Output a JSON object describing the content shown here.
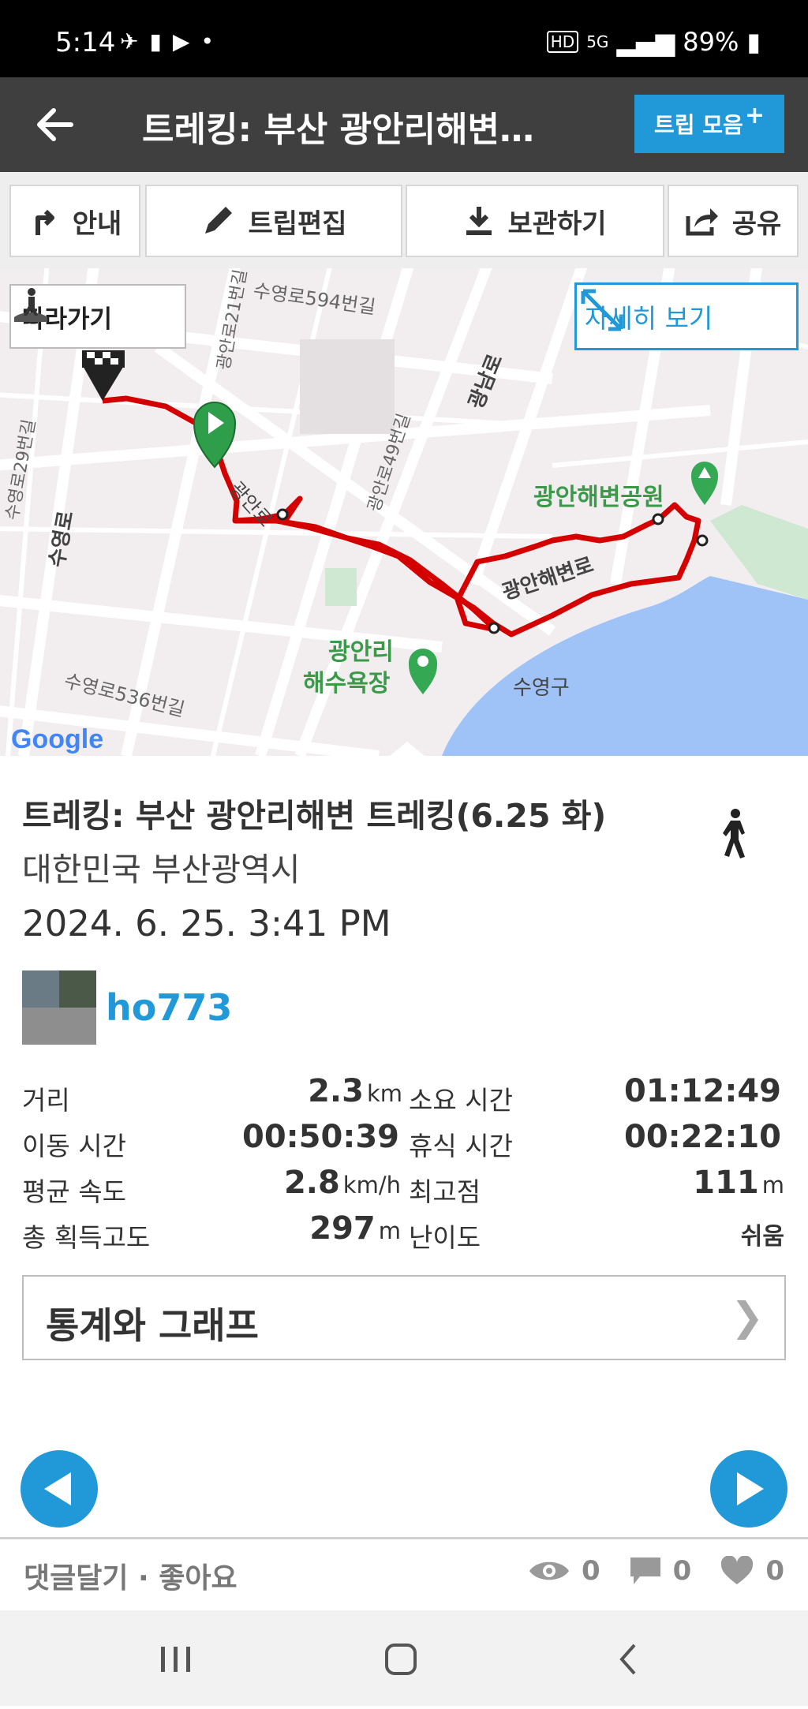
{
  "status_bar": {
    "time": "5:14",
    "battery": "89%",
    "network": "5G",
    "hd": "HD"
  },
  "app_bar": {
    "title": "트레킹: 부산 광안리해변…",
    "collect_label": "트립 모음"
  },
  "toolbar": {
    "guide": "안내",
    "edit": "트립편집",
    "save": "보관하기",
    "share": "공유"
  },
  "map": {
    "follow_label": "따라가기",
    "detail_label": "자세히 보기",
    "google": "Google",
    "labels": {
      "park": "광안해변공원",
      "beach_line1": "광안리",
      "beach_line2": "해수욕장",
      "sea_district": "수영구",
      "road_suyeong594": "수영로594번길",
      "road_suyeong536": "수영로536번길",
      "road_gwangan21": "광안로21번길",
      "road_gwangan49": "광안로49번길",
      "road_gwangnam": "광남로",
      "road_gwangan": "광안로",
      "road_gwanganhaebyeon": "광안해변로",
      "road_suyeong": "수영로",
      "road_suyeong29": "수영로29번길"
    }
  },
  "trip": {
    "title": "트레킹: 부산 광안리해변 트레킹(6.25 화)",
    "region": "대한민국 부산광역시",
    "datetime": "2024. 6. 25. 3:41 PM",
    "user": "ho773"
  },
  "stats": {
    "distance_label": "거리",
    "distance_value": "2.3",
    "distance_unit": "km",
    "duration_label": "소요 시간",
    "duration_value": "01:12:49",
    "moving_label": "이동 시간",
    "moving_value": "00:50:39",
    "rest_label": "휴식 시간",
    "rest_value": "00:22:10",
    "speed_label": "평균 속도",
    "speed_value": "2.8",
    "speed_unit": "km/h",
    "max_label": "최고점",
    "max_value": "111",
    "max_unit": "m",
    "gain_label": "총 획득고도",
    "gain_value": "297",
    "gain_unit": "m",
    "difficulty_label": "난이도",
    "difficulty_value": "쉬움"
  },
  "graph_button": {
    "label": "통계와 그래프",
    "chevron": "❯"
  },
  "footer": {
    "comment_like": "댓글달기 · 좋아요",
    "views": "0",
    "comments": "0",
    "likes": "0"
  },
  "colors": {
    "accent": "#2199d8",
    "route": "#d40000",
    "appbar": "#3f3f3f"
  }
}
